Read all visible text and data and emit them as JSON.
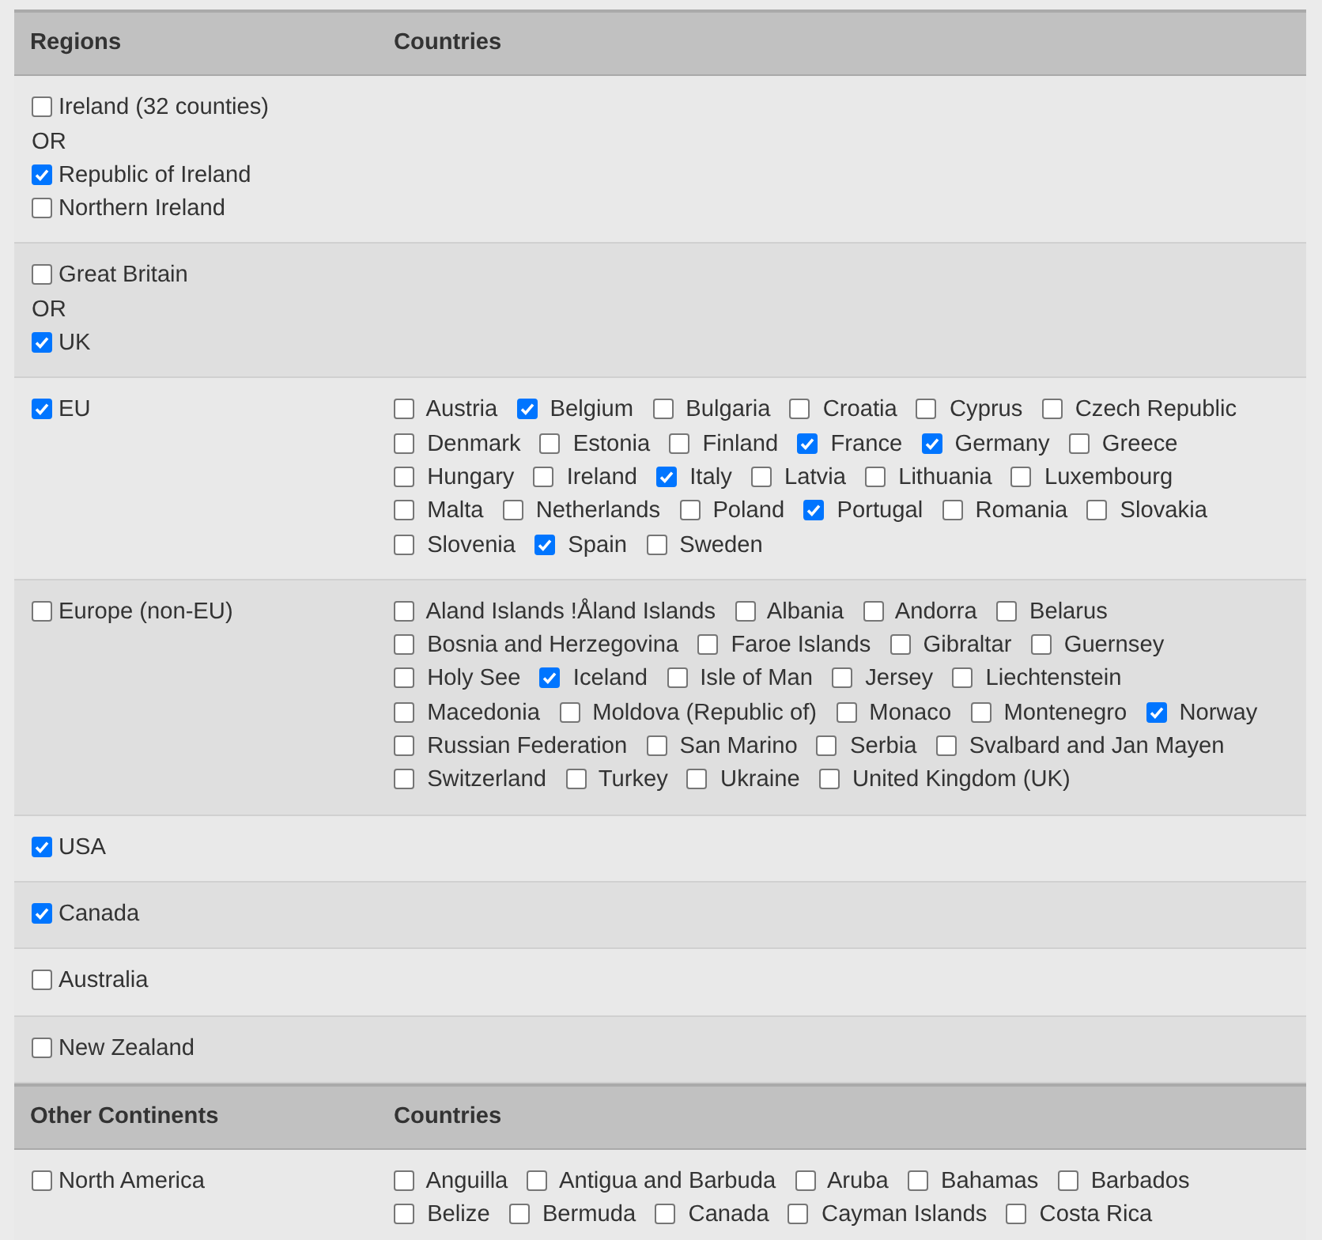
{
  "sections": [
    {
      "header": {
        "column_1": "Regions",
        "column_2": "Countries"
      },
      "rows": [
        {
          "regions": [
            {
              "kind": "checkbox",
              "label": "Ireland (32 counties)",
              "checked": false
            },
            {
              "kind": "separator",
              "label": "OR"
            },
            {
              "kind": "checkbox",
              "label": "Republic of Ireland",
              "checked": true
            },
            {
              "kind": "checkbox",
              "label": "Northern Ireland",
              "checked": false
            }
          ]
        },
        {
          "regions": [
            {
              "kind": "checkbox",
              "label": "Great Britain",
              "checked": false
            },
            {
              "kind": "separator",
              "label": "OR"
            },
            {
              "kind": "checkbox",
              "label": "UK",
              "checked": true
            }
          ]
        },
        {
          "regions": [
            {
              "kind": "checkbox",
              "label": "EU",
              "checked": true
            }
          ],
          "countries": [
            {
              "label": "Austria",
              "checked": false
            },
            {
              "label": "Belgium",
              "checked": true
            },
            {
              "label": "Bulgaria",
              "checked": false
            },
            {
              "label": "Croatia",
              "checked": false
            },
            {
              "label": "Cyprus",
              "checked": false
            },
            {
              "label": "Czech Republic",
              "checked": false
            },
            {
              "label": "Denmark",
              "checked": false
            },
            {
              "label": "Estonia",
              "checked": false
            },
            {
              "label": "Finland",
              "checked": false
            },
            {
              "label": "France",
              "checked": true
            },
            {
              "label": "Germany",
              "checked": true
            },
            {
              "label": "Greece",
              "checked": false
            },
            {
              "label": "Hungary",
              "checked": false
            },
            {
              "label": "Ireland",
              "checked": false
            },
            {
              "label": "Italy",
              "checked": true
            },
            {
              "label": "Latvia",
              "checked": false
            },
            {
              "label": "Lithuania",
              "checked": false
            },
            {
              "label": "Luxembourg",
              "checked": false
            },
            {
              "label": "Malta",
              "checked": false
            },
            {
              "label": "Netherlands",
              "checked": false
            },
            {
              "label": "Poland",
              "checked": false
            },
            {
              "label": "Portugal",
              "checked": true
            },
            {
              "label": "Romania",
              "checked": false
            },
            {
              "label": "Slovakia",
              "checked": false
            },
            {
              "label": "Slovenia",
              "checked": false
            },
            {
              "label": "Spain",
              "checked": true
            },
            {
              "label": "Sweden",
              "checked": false
            }
          ]
        },
        {
          "regions": [
            {
              "kind": "checkbox",
              "label": "Europe (non-EU)",
              "checked": false
            }
          ],
          "countries": [
            {
              "label": "Aland Islands !Åland Islands",
              "checked": false
            },
            {
              "label": "Albania",
              "checked": false
            },
            {
              "label": "Andorra",
              "checked": false
            },
            {
              "label": "Belarus",
              "checked": false
            },
            {
              "label": "Bosnia and Herzegovina",
              "checked": false
            },
            {
              "label": "Faroe Islands",
              "checked": false
            },
            {
              "label": "Gibraltar",
              "checked": false
            },
            {
              "label": "Guernsey",
              "checked": false
            },
            {
              "label": "Holy See",
              "checked": false
            },
            {
              "label": "Iceland",
              "checked": true
            },
            {
              "label": "Isle of Man",
              "checked": false
            },
            {
              "label": "Jersey",
              "checked": false
            },
            {
              "label": "Liechtenstein",
              "checked": false
            },
            {
              "label": "Macedonia",
              "checked": false
            },
            {
              "label": "Moldova (Republic of)",
              "checked": false
            },
            {
              "label": "Monaco",
              "checked": false
            },
            {
              "label": "Montenegro",
              "checked": false
            },
            {
              "label": "Norway",
              "checked": true
            },
            {
              "label": "Russian Federation",
              "checked": false
            },
            {
              "label": "San Marino",
              "checked": false
            },
            {
              "label": "Serbia",
              "checked": false
            },
            {
              "label": "Svalbard and Jan Mayen",
              "checked": false
            },
            {
              "label": "Switzerland",
              "checked": false
            },
            {
              "label": "Turkey",
              "checked": false
            },
            {
              "label": "Ukraine",
              "checked": false
            },
            {
              "label": "United Kingdom (UK)",
              "checked": false
            }
          ]
        },
        {
          "regions": [
            {
              "kind": "checkbox",
              "label": "USA",
              "checked": true
            }
          ]
        },
        {
          "regions": [
            {
              "kind": "checkbox",
              "label": "Canada",
              "checked": true
            }
          ]
        },
        {
          "regions": [
            {
              "kind": "checkbox",
              "label": "Australia",
              "checked": false
            }
          ]
        },
        {
          "regions": [
            {
              "kind": "checkbox",
              "label": "New Zealand",
              "checked": false
            }
          ]
        }
      ]
    },
    {
      "header": {
        "column_1": "Other Continents",
        "column_2": "Countries"
      },
      "rows": [
        {
          "regions": [
            {
              "kind": "checkbox",
              "label": "North America",
              "checked": false
            }
          ],
          "countries": [
            {
              "label": "Anguilla",
              "checked": false
            },
            {
              "label": "Antigua and Barbuda",
              "checked": false
            },
            {
              "label": "Aruba",
              "checked": false
            },
            {
              "label": "Bahamas",
              "checked": false
            },
            {
              "label": "Barbados",
              "checked": false
            },
            {
              "label": "Belize",
              "checked": false
            },
            {
              "label": "Bermuda",
              "checked": false
            },
            {
              "label": "Canada",
              "checked": false
            },
            {
              "label": "Cayman Islands",
              "checked": false
            },
            {
              "label": "Costa Rica",
              "checked": false
            }
          ]
        }
      ]
    }
  ]
}
